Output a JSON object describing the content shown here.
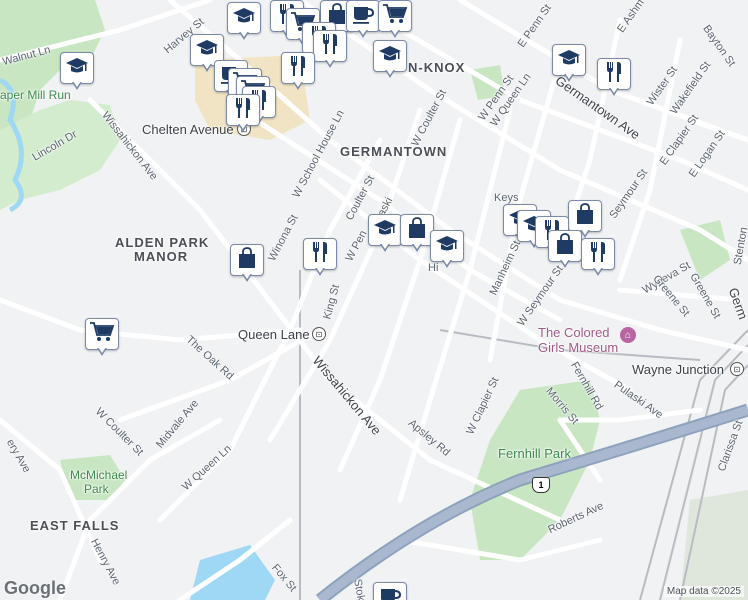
{
  "map": {
    "colors": {
      "background": "#f1f2f4",
      "road": "#ffffff",
      "highway": "#8fa2bd",
      "park": "#c8e6c2",
      "water": "#9fd8f5",
      "rail": "#b8bcc2",
      "marker_border": "#7a8aa8",
      "marker_icon": "#1f3a63",
      "poi": "#b865a2"
    },
    "area_labels": [
      {
        "text": "GERMANTOWN"
      },
      {
        "text": "ALDEN PARK"
      },
      {
        "text": "MANOR"
      },
      {
        "text": "EAST FALLS"
      },
      {
        "text": "N-KNOX"
      }
    ],
    "park_labels": [
      {
        "text": "McMichael"
      },
      {
        "text": "Park"
      },
      {
        "text": "Fernhill Park"
      },
      {
        "text": "aper Mill Run"
      }
    ],
    "station_labels": [
      {
        "text": "Queen Lane"
      },
      {
        "text": "Wayne Junction"
      },
      {
        "text": "Chelten Avenue"
      }
    ],
    "poi_labels": [
      {
        "text": "The Colored"
      },
      {
        "text": "Girls Museum"
      }
    ],
    "street_labels": [
      {
        "text": "Harvey St"
      },
      {
        "text": "Walnut Ln"
      },
      {
        "text": "Lincoln Dr"
      },
      {
        "text": "Wissahickon Ave"
      },
      {
        "text": "W School House Ln"
      },
      {
        "text": "Winona St"
      },
      {
        "text": "Coulter St"
      },
      {
        "text": "W Coulter St"
      },
      {
        "text": "W Penn St"
      },
      {
        "text": "W Queen Ln"
      },
      {
        "text": "E Penn St"
      },
      {
        "text": "Germantown Ave"
      },
      {
        "text": "Wister St"
      },
      {
        "text": "Wakefield St"
      },
      {
        "text": "E Clapier St"
      },
      {
        "text": "E Logan St"
      },
      {
        "text": "Bayton St"
      },
      {
        "text": "Manheim St"
      },
      {
        "text": "W Seymour St"
      },
      {
        "text": "Seymour St"
      },
      {
        "text": "Wyneva St"
      },
      {
        "text": "Greene St"
      },
      {
        "text": "King St"
      },
      {
        "text": "The Oak Rd"
      },
      {
        "text": "Midvale Ave"
      },
      {
        "text": "Wissahickon Ave"
      },
      {
        "text": "W Clapier St"
      },
      {
        "text": "Fernhill Rd"
      },
      {
        "text": "Morris St"
      },
      {
        "text": "Pulaski Ave"
      },
      {
        "text": "Clarissa St"
      },
      {
        "text": "W Coulter St"
      },
      {
        "text": "W Queen Ln"
      },
      {
        "text": "Henry Ave"
      },
      {
        "text": "Fox St"
      },
      {
        "text": "Roberts Ave"
      },
      {
        "text": "Apsley Rd"
      },
      {
        "text": "Greene St"
      },
      {
        "text": "E Ashm"
      },
      {
        "text": "Stenton"
      },
      {
        "text": "Germ"
      },
      {
        "text": "Stok"
      },
      {
        "text": "ery Ave"
      },
      {
        "text": "Pulaski"
      },
      {
        "text": "W Pen"
      },
      {
        "text": "Keys"
      },
      {
        "text": "Hi"
      }
    ],
    "route_shield": "1",
    "markers": [
      {
        "icon": "school-icon"
      },
      {
        "icon": "restaurant-icon"
      },
      {
        "icon": "shopping-icon"
      },
      {
        "icon": "cafe-icon"
      },
      {
        "icon": "grocery-icon"
      },
      {
        "icon": "grocery-icon"
      },
      {
        "icon": "restaurant-icon"
      },
      {
        "icon": "restaurant-icon"
      },
      {
        "icon": "school-icon"
      },
      {
        "icon": "school-icon"
      },
      {
        "icon": "cafe-icon"
      },
      {
        "icon": "grocery-icon"
      },
      {
        "icon": "grocery-icon"
      },
      {
        "icon": "restaurant-icon"
      },
      {
        "icon": "restaurant-icon"
      },
      {
        "icon": "restaurant-icon"
      },
      {
        "icon": "school-icon"
      },
      {
        "icon": "school-icon"
      },
      {
        "icon": "restaurant-icon"
      },
      {
        "icon": "shopping-icon"
      },
      {
        "icon": "school-icon"
      },
      {
        "icon": "school-icon"
      },
      {
        "icon": "restaurant-icon"
      },
      {
        "icon": "school-icon"
      },
      {
        "icon": "shopping-icon"
      },
      {
        "icon": "shopping-icon"
      },
      {
        "icon": "restaurant-icon"
      },
      {
        "icon": "restaurant-icon"
      },
      {
        "icon": "shopping-icon"
      },
      {
        "icon": "school-icon"
      },
      {
        "icon": "grocery-icon"
      },
      {
        "icon": "cafe-icon"
      }
    ],
    "branding": {
      "logo": "Google",
      "attribution": "Map data ©2025"
    }
  }
}
